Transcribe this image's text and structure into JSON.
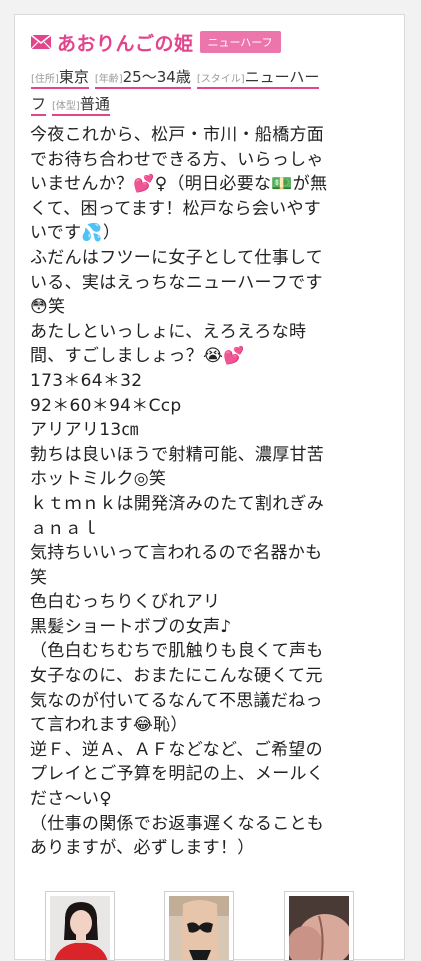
{
  "profile": {
    "name": "あおりんごの姫",
    "badge": "ニューハーフ",
    "meta": [
      {
        "label": "[住所]",
        "value": "東京"
      },
      {
        "label": "[年齢]",
        "value": "25〜34歳"
      },
      {
        "label": "[スタイル]",
        "value": "ニューハー"
      },
      {
        "label": "",
        "value": "フ"
      },
      {
        "label": "[体型]",
        "value": "普通"
      }
    ]
  },
  "body_lines": [
    "今夜これから、松戸・市川・船橋方面",
    "でお待ち合わせできる方、いらっしゃ",
    "いませんか？💕♀（明日必要な💵が無",
    "くて、困ってます！松戸なら会いやす",
    "いです💦）",
    "ふだんはフツーに女子として仕事して",
    "いる、実はえっちなニューハーフです",
    "😳笑",
    "あたしといっしょに、えろえろな時",
    "間、すごしましょっ？😭💕",
    "173＊64＊32",
    "92＊60＊94＊Ccp",
    "アリアリ13㎝",
    "勃ちは良いほうで射精可能、濃厚甘苦",
    "ホットミルク◎笑",
    "ｋｔｍｎｋは開発済みのたて割れぎみ",
    "ａｎａｌ",
    "気持ちいいって言われるので名器かも",
    "笑",
    "色白むっちりくびれアリ",
    "黒髪ショートボブの女声♪",
    "（色白むちむちで肌触りも良くて声も",
    "女子なのに、おまたにこんな硬くて元",
    "気なのが付いてるなんて不思議だねっ",
    "て言われます😂恥）",
    "逆Ｆ、逆Ａ、ＡＦなどなど、ご希望の",
    "プレイとご予算を明記の上、メールく",
    "ださ〜い♀",
    "（仕事の関係でお返事遅くなることも",
    "ありますが、必ずします！）"
  ],
  "colors": {
    "accent": "#e2458c",
    "badge_bg": "#ec75ac"
  },
  "icons": {
    "title": "mail-icon"
  }
}
